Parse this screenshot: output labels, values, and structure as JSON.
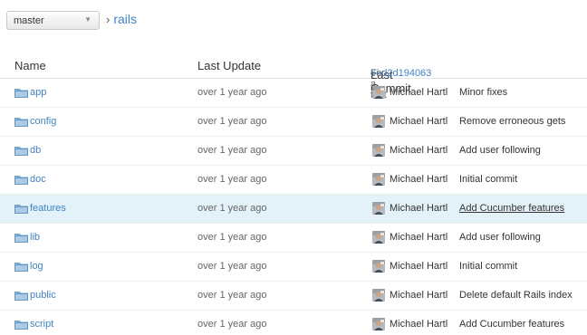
{
  "branch": {
    "value": "master"
  },
  "breadcrumb": {
    "separator": "›",
    "repo": "rails"
  },
  "table": {
    "headers": {
      "name": "Name",
      "last_update": "Last Update",
      "last_commit": "Last Commit",
      "commit_chevron": "›",
      "commit_sha": "6ed2d194063",
      "commit_dash": "–",
      "commit_msg": "Fix a test"
    },
    "rows": [
      {
        "name": "app",
        "age": "over 1 year ago",
        "author": "Michael Hartl",
        "message": "Minor fixes"
      },
      {
        "name": "config",
        "age": "over 1 year ago",
        "author": "Michael Hartl",
        "message": "Remove erroneous gets"
      },
      {
        "name": "db",
        "age": "over 1 year ago",
        "author": "Michael Hartl",
        "message": "Add user following"
      },
      {
        "name": "doc",
        "age": "over 1 year ago",
        "author": "Michael Hartl",
        "message": "Initial commit"
      },
      {
        "name": "features",
        "age": "over 1 year ago",
        "author": "Michael Hartl",
        "message": "Add Cucumber features",
        "hover": true
      },
      {
        "name": "lib",
        "age": "over 1 year ago",
        "author": "Michael Hartl",
        "message": "Add user following"
      },
      {
        "name": "log",
        "age": "over 1 year ago",
        "author": "Michael Hartl",
        "message": "Initial commit"
      },
      {
        "name": "public",
        "age": "over 1 year ago",
        "author": "Michael Hartl",
        "message": "Delete default Rails index"
      },
      {
        "name": "script",
        "age": "over 1 year ago",
        "author": "Michael Hartl",
        "message": "Add Cucumber features"
      }
    ]
  },
  "colors": {
    "link": "#4183c4",
    "hover_row": "#e3f1f9",
    "folder": "#8cb4d8"
  }
}
